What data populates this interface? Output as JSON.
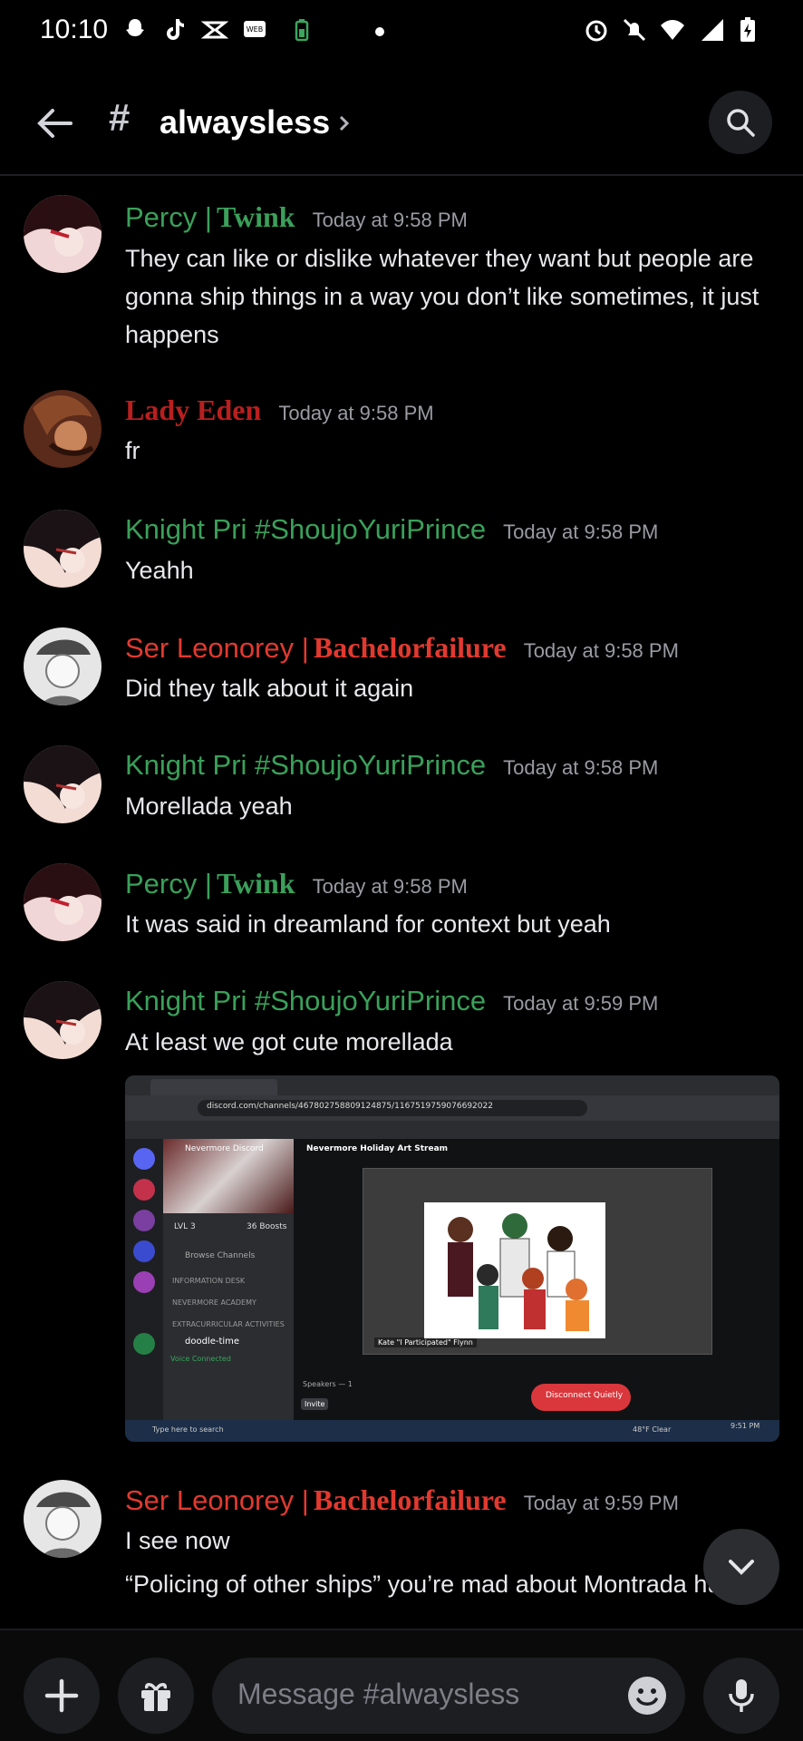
{
  "status_bar": {
    "time": "10:10"
  },
  "header": {
    "channel": "alwaysless"
  },
  "messages": [
    {
      "author": "Percy |",
      "author_fancy": "Twink",
      "time": "Today at 9:58 PM",
      "text": "They can like or dislike whatever they want but people are gonna ship things in a way you don’t like sometimes, it just happens"
    },
    {
      "author": "",
      "author_fancy": "Lady Eden",
      "time": "Today at 9:58 PM",
      "text": "fr"
    },
    {
      "author": "Knight Pri #ShoujoYuriPrince",
      "author_fancy": "",
      "time": "Today at 9:58 PM",
      "text": "Yeahh"
    },
    {
      "author": "Ser Leonorey |",
      "author_fancy": "Bachelorfailure",
      "time": "Today at 9:58 PM",
      "text": "Did they talk about it again"
    },
    {
      "author": "Knight Pri #ShoujoYuriPrince",
      "author_fancy": "",
      "time": "Today at 9:58 PM",
      "text": "Morellada yeah"
    },
    {
      "author": "Percy |",
      "author_fancy": "Twink",
      "time": "Today at 9:58 PM",
      "text": "It was said in dreamland for context but yeah"
    },
    {
      "author": "Knight Pri #ShoujoYuriPrince",
      "author_fancy": "",
      "time": "Today at 9:59 PM",
      "text": "At least we got cute morellada"
    },
    {
      "author": "Ser Leonorey |",
      "author_fancy": "Bachelorfailure",
      "time": "Today at 9:59 PM",
      "text": "I see now",
      "text2": "“Policing of other ships” you’re mad about Montrada huh"
    }
  ],
  "attachment": {
    "url": "discord.com/channels/467802758809124875/1167519759076692022",
    "stream_title": "Nevermore Holiday Art Stream",
    "server_name": "Nevermore Discord",
    "level": "LVL 3",
    "boosts": "36 Boosts",
    "browse_channels": "Browse Channels",
    "categories": [
      "INFORMATION DESK",
      "NEVERMORE ACADEMY",
      "EXTRACURRICULAR ACTIVITIES"
    ],
    "voice_channel": "doodle-time",
    "voice_connected": "Voice Connected",
    "speakers": "Speakers — 1",
    "invite": "Invite",
    "disconnect": "Disconnect Quietly",
    "streamer_caption": "Kate \"I Participated\" Flynn",
    "taskbar_search": "Type here to search",
    "weather": "48°F Clear",
    "clock": "9:51 PM"
  },
  "composer": {
    "placeholder": "Message #alwaysless"
  },
  "colors": {
    "green_role": "#3aa05a",
    "red_role": "#e2392f",
    "background": "#000000"
  }
}
